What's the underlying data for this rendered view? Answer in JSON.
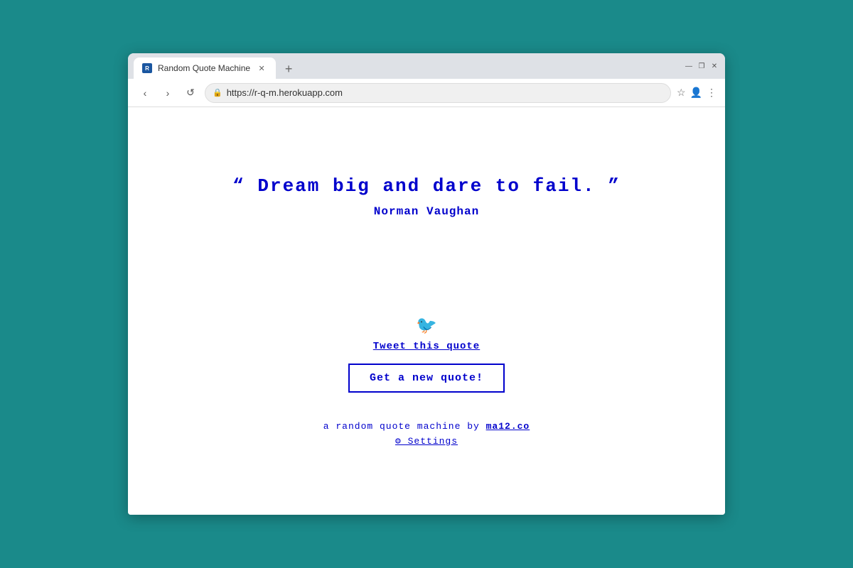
{
  "browser": {
    "tab_title": "Random Quote Machine",
    "url": "https://r-q-m.herokuapp.com",
    "new_tab_symbol": "+",
    "window_minimize": "—",
    "window_restore": "❐",
    "window_close": "✕",
    "nav_back": "‹",
    "nav_forward": "›",
    "nav_refresh": "↺"
  },
  "quote": {
    "open_mark": "“",
    "text": "Dream big and dare to fail.",
    "close_mark": "”",
    "full_display": "“ Dream big and dare to fail. ”",
    "author": "Norman Vaughan"
  },
  "actions": {
    "tweet_label": "Tweet this quote",
    "new_quote_label": "Get a new quote!"
  },
  "footer": {
    "prefix": "a random quote machine by ",
    "link_text": "ma12.co",
    "link_url": "https://ma12.co",
    "settings_label": "⚙ Settings"
  }
}
